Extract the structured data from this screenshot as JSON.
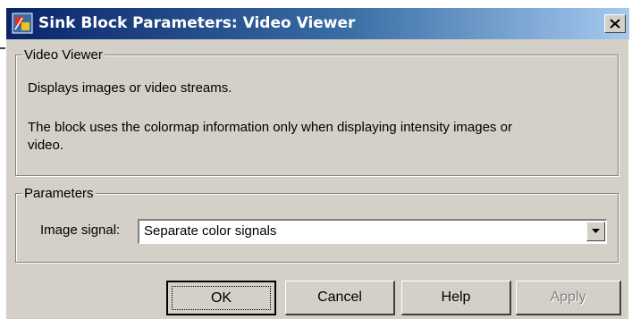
{
  "window": {
    "title": "Sink Block Parameters: Video Viewer",
    "close_label": "×"
  },
  "video_viewer_group": {
    "legend": "Video Viewer",
    "description_1": "Displays images or video streams.",
    "description_2_line1": "The block uses the colormap information only when displaying intensity images or",
    "description_2_line2": "video."
  },
  "parameters_group": {
    "legend": "Parameters",
    "image_signal_label": "Image signal:",
    "image_signal_value": "Separate color signals"
  },
  "buttons": {
    "ok": "OK",
    "cancel": "Cancel",
    "help": "Help",
    "apply": "Apply"
  },
  "icons": {
    "app": "simulink-block-icon",
    "close": "close-icon",
    "dropdown": "chevron-down-icon"
  },
  "colors": {
    "titlebar_start": "#0a246a",
    "titlebar_end": "#a6caf0",
    "face": "#d4d0c8"
  }
}
